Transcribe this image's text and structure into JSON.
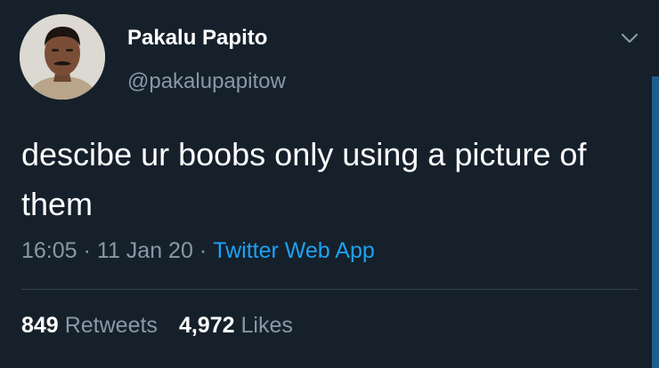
{
  "user": {
    "display_name": "Pakalu Papito",
    "handle": "@pakalupapitow",
    "avatar": "profile-photo"
  },
  "tweet": {
    "text": "descibe ur boobs only using a picture of them",
    "time": "16:05",
    "date": "11 Jan 20",
    "separator": "·",
    "source": "Twitter Web App"
  },
  "stats": {
    "retweets_count": "849",
    "retweets_label": "Retweets",
    "likes_count": "4,972",
    "likes_label": "Likes"
  },
  "icons": {
    "menu": "chevron-down-icon"
  },
  "colors": {
    "background": "#15202b",
    "text": "#ffffff",
    "muted": "#8899a6",
    "link": "#1da1f2",
    "divider": "#38444d"
  }
}
